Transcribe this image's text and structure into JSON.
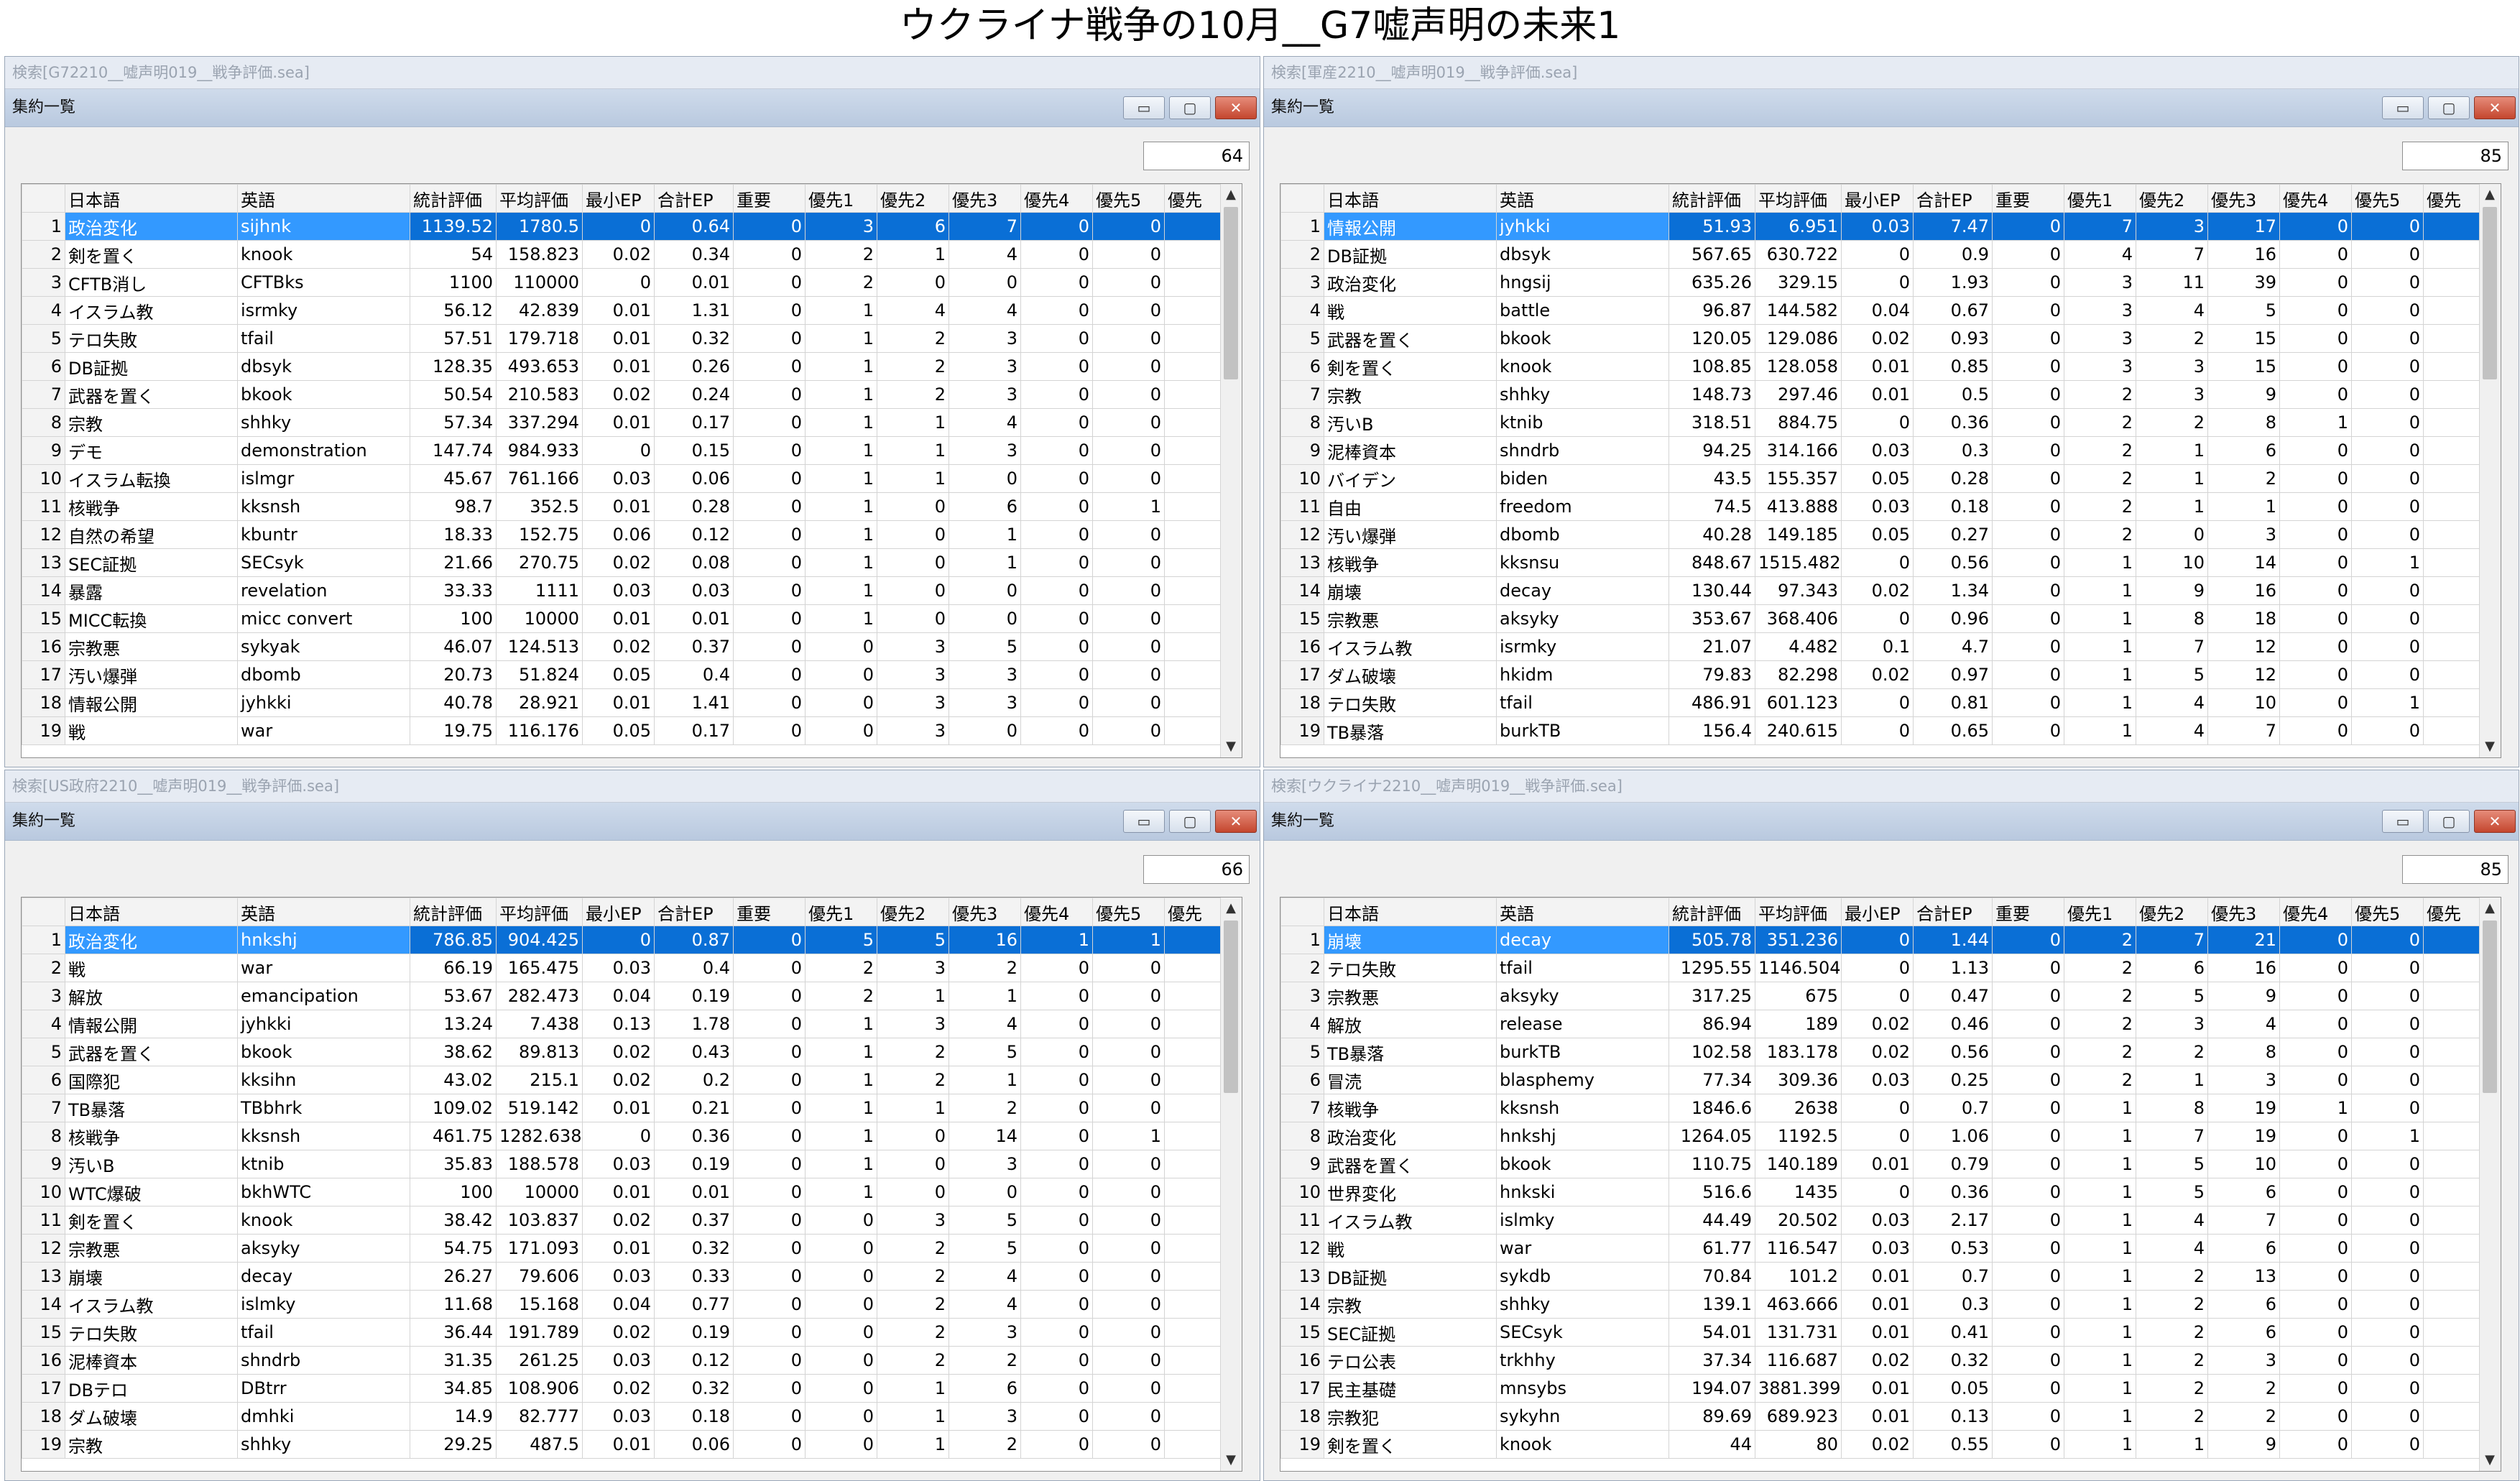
{
  "page_title": "ウクライナ戦争の10月__G7嘘声明の未来1",
  "columns": [
    "日本語",
    "英語",
    "統計評価",
    "平均評価",
    "最小EP",
    "合計EP",
    "重要",
    "優先1",
    "優先2",
    "優先3",
    "優先4",
    "優先5",
    "優先"
  ],
  "window_buttons": {
    "minimize": "▭",
    "maximize": "▢",
    "close": "✕"
  },
  "scroll_arrows": {
    "up": "▲",
    "down": "▼"
  },
  "panels": [
    {
      "window_title": "検索[G72210__嘘声明019__戦争評価.sea]",
      "list_title": "集約一覧",
      "count": "64",
      "rows": [
        [
          "1",
          "政治変化",
          "sijhnk",
          "1139.52",
          "1780.5",
          "0",
          "0.64",
          "0",
          "3",
          "6",
          "7",
          "0",
          "0"
        ],
        [
          "2",
          "剣を置く",
          "knook",
          "54",
          "158.823",
          "0.02",
          "0.34",
          "0",
          "2",
          "1",
          "4",
          "0",
          "0"
        ],
        [
          "3",
          "CFTB消し",
          "CFTBks",
          "1100",
          "110000",
          "0",
          "0.01",
          "0",
          "2",
          "0",
          "0",
          "0",
          "0"
        ],
        [
          "4",
          "イスラム教",
          "isrmky",
          "56.12",
          "42.839",
          "0.01",
          "1.31",
          "0",
          "1",
          "4",
          "4",
          "0",
          "0"
        ],
        [
          "5",
          "テロ失敗",
          "tfail",
          "57.51",
          "179.718",
          "0.01",
          "0.32",
          "0",
          "1",
          "2",
          "3",
          "0",
          "0"
        ],
        [
          "6",
          "DB証拠",
          "dbsyk",
          "128.35",
          "493.653",
          "0.01",
          "0.26",
          "0",
          "1",
          "2",
          "3",
          "0",
          "0"
        ],
        [
          "7",
          "武器を置く",
          "bkook",
          "50.54",
          "210.583",
          "0.02",
          "0.24",
          "0",
          "1",
          "2",
          "3",
          "0",
          "0"
        ],
        [
          "8",
          "宗教",
          "shhky",
          "57.34",
          "337.294",
          "0.01",
          "0.17",
          "0",
          "1",
          "1",
          "4",
          "0",
          "0"
        ],
        [
          "9",
          "デモ",
          "demonstration",
          "147.74",
          "984.933",
          "0",
          "0.15",
          "0",
          "1",
          "1",
          "3",
          "0",
          "0"
        ],
        [
          "10",
          "イスラム転換",
          "islmgr",
          "45.67",
          "761.166",
          "0.03",
          "0.06",
          "0",
          "1",
          "1",
          "0",
          "0",
          "0"
        ],
        [
          "11",
          "核戦争",
          "kksnsh",
          "98.7",
          "352.5",
          "0.01",
          "0.28",
          "0",
          "1",
          "0",
          "6",
          "0",
          "1"
        ],
        [
          "12",
          "自然の希望",
          "kbuntr",
          "18.33",
          "152.75",
          "0.06",
          "0.12",
          "0",
          "1",
          "0",
          "1",
          "0",
          "0"
        ],
        [
          "13",
          "SEC証拠",
          "SECsyk",
          "21.66",
          "270.75",
          "0.02",
          "0.08",
          "0",
          "1",
          "0",
          "1",
          "0",
          "0"
        ],
        [
          "14",
          "暴露",
          "revelation",
          "33.33",
          "1111",
          "0.03",
          "0.03",
          "0",
          "1",
          "0",
          "0",
          "0",
          "0"
        ],
        [
          "15",
          "MICC転換",
          "micc convert",
          "100",
          "10000",
          "0.01",
          "0.01",
          "0",
          "1",
          "0",
          "0",
          "0",
          "0"
        ],
        [
          "16",
          "宗教悪",
          "sykyak",
          "46.07",
          "124.513",
          "0.02",
          "0.37",
          "0",
          "0",
          "3",
          "5",
          "0",
          "0"
        ],
        [
          "17",
          "汚い爆弾",
          "dbomb",
          "20.73",
          "51.824",
          "0.05",
          "0.4",
          "0",
          "0",
          "3",
          "3",
          "0",
          "0"
        ],
        [
          "18",
          "情報公開",
          "jyhkki",
          "40.78",
          "28.921",
          "0.01",
          "1.41",
          "0",
          "0",
          "3",
          "3",
          "0",
          "0"
        ],
        [
          "19",
          "戦",
          "war",
          "19.75",
          "116.176",
          "0.05",
          "0.17",
          "0",
          "0",
          "3",
          "0",
          "0",
          "0"
        ]
      ]
    },
    {
      "window_title": "検索[軍産2210__嘘声明019__戦争評価.sea]",
      "list_title": "集約一覧",
      "count": "85",
      "rows": [
        [
          "1",
          "情報公開",
          "jyhkki",
          "51.93",
          "6.951",
          "0.03",
          "7.47",
          "0",
          "7",
          "3",
          "17",
          "0",
          "0"
        ],
        [
          "2",
          "DB証拠",
          "dbsyk",
          "567.65",
          "630.722",
          "0",
          "0.9",
          "0",
          "4",
          "7",
          "16",
          "0",
          "0"
        ],
        [
          "3",
          "政治変化",
          "hngsij",
          "635.26",
          "329.15",
          "0",
          "1.93",
          "0",
          "3",
          "11",
          "39",
          "0",
          "0"
        ],
        [
          "4",
          "戦",
          "battle",
          "96.87",
          "144.582",
          "0.04",
          "0.67",
          "0",
          "3",
          "4",
          "5",
          "0",
          "0"
        ],
        [
          "5",
          "武器を置く",
          "bkook",
          "120.05",
          "129.086",
          "0.02",
          "0.93",
          "0",
          "3",
          "2",
          "15",
          "0",
          "0"
        ],
        [
          "6",
          "剣を置く",
          "knook",
          "108.85",
          "128.058",
          "0.01",
          "0.85",
          "0",
          "3",
          "3",
          "15",
          "0",
          "0"
        ],
        [
          "7",
          "宗教",
          "shhky",
          "148.73",
          "297.46",
          "0.01",
          "0.5",
          "0",
          "2",
          "3",
          "9",
          "0",
          "0"
        ],
        [
          "8",
          "汚いB",
          "ktnib",
          "318.51",
          "884.75",
          "0",
          "0.36",
          "0",
          "2",
          "2",
          "8",
          "1",
          "0"
        ],
        [
          "9",
          "泥棒資本",
          "shndrb",
          "94.25",
          "314.166",
          "0.03",
          "0.3",
          "0",
          "2",
          "1",
          "6",
          "0",
          "0"
        ],
        [
          "10",
          "バイデン",
          "biden",
          "43.5",
          "155.357",
          "0.05",
          "0.28",
          "0",
          "2",
          "1",
          "2",
          "0",
          "0"
        ],
        [
          "11",
          "自由",
          "freedom",
          "74.5",
          "413.888",
          "0.03",
          "0.18",
          "0",
          "2",
          "1",
          "1",
          "0",
          "0"
        ],
        [
          "12",
          "汚い爆弾",
          "dbomb",
          "40.28",
          "149.185",
          "0.05",
          "0.27",
          "0",
          "2",
          "0",
          "3",
          "0",
          "0"
        ],
        [
          "13",
          "核戦争",
          "kksnsu",
          "848.67",
          "1515.482",
          "0",
          "0.56",
          "0",
          "1",
          "10",
          "14",
          "0",
          "1"
        ],
        [
          "14",
          "崩壊",
          "decay",
          "130.44",
          "97.343",
          "0.02",
          "1.34",
          "0",
          "1",
          "9",
          "16",
          "0",
          "0"
        ],
        [
          "15",
          "宗教悪",
          "aksyky",
          "353.67",
          "368.406",
          "0",
          "0.96",
          "0",
          "1",
          "8",
          "18",
          "0",
          "0"
        ],
        [
          "16",
          "イスラム教",
          "isrmky",
          "21.07",
          "4.482",
          "0.1",
          "4.7",
          "0",
          "1",
          "7",
          "12",
          "0",
          "0"
        ],
        [
          "17",
          "ダム破壊",
          "hkidm",
          "79.83",
          "82.298",
          "0.02",
          "0.97",
          "0",
          "1",
          "5",
          "12",
          "0",
          "0"
        ],
        [
          "18",
          "テロ失敗",
          "tfail",
          "486.91",
          "601.123",
          "0",
          "0.81",
          "0",
          "1",
          "4",
          "10",
          "0",
          "1"
        ],
        [
          "19",
          "TB暴落",
          "burkTB",
          "156.4",
          "240.615",
          "0",
          "0.65",
          "0",
          "1",
          "4",
          "7",
          "0",
          "0"
        ]
      ]
    },
    {
      "window_title": "検索[US政府2210__嘘声明019__戦争評価.sea]",
      "list_title": "集約一覧",
      "count": "66",
      "rows": [
        [
          "1",
          "政治変化",
          "hnkshj",
          "786.85",
          "904.425",
          "0",
          "0.87",
          "0",
          "5",
          "5",
          "16",
          "1",
          "1"
        ],
        [
          "2",
          "戦",
          "war",
          "66.19",
          "165.475",
          "0.03",
          "0.4",
          "0",
          "2",
          "3",
          "2",
          "0",
          "0"
        ],
        [
          "3",
          "解放",
          "emancipation",
          "53.67",
          "282.473",
          "0.04",
          "0.19",
          "0",
          "2",
          "1",
          "1",
          "0",
          "0"
        ],
        [
          "4",
          "情報公開",
          "jyhkki",
          "13.24",
          "7.438",
          "0.13",
          "1.78",
          "0",
          "1",
          "3",
          "4",
          "0",
          "0"
        ],
        [
          "5",
          "武器を置く",
          "bkook",
          "38.62",
          "89.813",
          "0.02",
          "0.43",
          "0",
          "1",
          "2",
          "5",
          "0",
          "0"
        ],
        [
          "6",
          "国際犯",
          "kksihn",
          "43.02",
          "215.1",
          "0.02",
          "0.2",
          "0",
          "1",
          "2",
          "1",
          "0",
          "0"
        ],
        [
          "7",
          "TB暴落",
          "TBbhrk",
          "109.02",
          "519.142",
          "0.01",
          "0.21",
          "0",
          "1",
          "1",
          "2",
          "0",
          "0"
        ],
        [
          "8",
          "核戦争",
          "kksnsh",
          "461.75",
          "1282.638",
          "0",
          "0.36",
          "0",
          "1",
          "0",
          "14",
          "0",
          "1"
        ],
        [
          "9",
          "汚いB",
          "ktnib",
          "35.83",
          "188.578",
          "0.03",
          "0.19",
          "0",
          "1",
          "0",
          "3",
          "0",
          "0"
        ],
        [
          "10",
          "WTC爆破",
          "bkhWTC",
          "100",
          "10000",
          "0.01",
          "0.01",
          "0",
          "1",
          "0",
          "0",
          "0",
          "0"
        ],
        [
          "11",
          "剣を置く",
          "knook",
          "38.42",
          "103.837",
          "0.02",
          "0.37",
          "0",
          "0",
          "3",
          "5",
          "0",
          "0"
        ],
        [
          "12",
          "宗教悪",
          "aksyky",
          "54.75",
          "171.093",
          "0.01",
          "0.32",
          "0",
          "0",
          "2",
          "5",
          "0",
          "0"
        ],
        [
          "13",
          "崩壊",
          "decay",
          "26.27",
          "79.606",
          "0.03",
          "0.33",
          "0",
          "0",
          "2",
          "4",
          "0",
          "0"
        ],
        [
          "14",
          "イスラム教",
          "islmky",
          "11.68",
          "15.168",
          "0.04",
          "0.77",
          "0",
          "0",
          "2",
          "4",
          "0",
          "0"
        ],
        [
          "15",
          "テロ失敗",
          "tfail",
          "36.44",
          "191.789",
          "0.02",
          "0.19",
          "0",
          "0",
          "2",
          "3",
          "0",
          "0"
        ],
        [
          "16",
          "泥棒資本",
          "shndrb",
          "31.35",
          "261.25",
          "0.03",
          "0.12",
          "0",
          "0",
          "2",
          "2",
          "0",
          "0"
        ],
        [
          "17",
          "DBテロ",
          "DBtrr",
          "34.85",
          "108.906",
          "0.02",
          "0.32",
          "0",
          "0",
          "1",
          "6",
          "0",
          "0"
        ],
        [
          "18",
          "ダム破壊",
          "dmhki",
          "14.9",
          "82.777",
          "0.03",
          "0.18",
          "0",
          "0",
          "1",
          "3",
          "0",
          "0"
        ],
        [
          "19",
          "宗教",
          "shhky",
          "29.25",
          "487.5",
          "0.01",
          "0.06",
          "0",
          "0",
          "1",
          "2",
          "0",
          "0"
        ]
      ]
    },
    {
      "window_title": "検索[ウクライナ2210__嘘声明019__戦争評価.sea]",
      "list_title": "集約一覧",
      "count": "85",
      "rows": [
        [
          "1",
          "崩壊",
          "decay",
          "505.78",
          "351.236",
          "0",
          "1.44",
          "0",
          "2",
          "7",
          "21",
          "0",
          "0"
        ],
        [
          "2",
          "テロ失敗",
          "tfail",
          "1295.55",
          "1146.504",
          "0",
          "1.13",
          "0",
          "2",
          "6",
          "16",
          "0",
          "0"
        ],
        [
          "3",
          "宗教悪",
          "aksyky",
          "317.25",
          "675",
          "0",
          "0.47",
          "0",
          "2",
          "5",
          "9",
          "0",
          "0"
        ],
        [
          "4",
          "解放",
          "release",
          "86.94",
          "189",
          "0.02",
          "0.46",
          "0",
          "2",
          "3",
          "4",
          "0",
          "0"
        ],
        [
          "5",
          "TB暴落",
          "burkTB",
          "102.58",
          "183.178",
          "0.02",
          "0.56",
          "0",
          "2",
          "2",
          "8",
          "0",
          "0"
        ],
        [
          "6",
          "冒涜",
          "blasphemy",
          "77.34",
          "309.36",
          "0.03",
          "0.25",
          "0",
          "2",
          "1",
          "3",
          "0",
          "0"
        ],
        [
          "7",
          "核戦争",
          "kksnsh",
          "1846.6",
          "2638",
          "0",
          "0.7",
          "0",
          "1",
          "8",
          "19",
          "1",
          "0"
        ],
        [
          "8",
          "政治変化",
          "hnkshj",
          "1264.05",
          "1192.5",
          "0",
          "1.06",
          "0",
          "1",
          "7",
          "19",
          "0",
          "1"
        ],
        [
          "9",
          "武器を置く",
          "bkook",
          "110.75",
          "140.189",
          "0.01",
          "0.79",
          "0",
          "1",
          "5",
          "10",
          "0",
          "0"
        ],
        [
          "10",
          "世界変化",
          "hnkski",
          "516.6",
          "1435",
          "0",
          "0.36",
          "0",
          "1",
          "5",
          "6",
          "0",
          "0"
        ],
        [
          "11",
          "イスラム教",
          "islmky",
          "44.49",
          "20.502",
          "0.03",
          "2.17",
          "0",
          "1",
          "4",
          "7",
          "0",
          "0"
        ],
        [
          "12",
          "戦",
          "war",
          "61.77",
          "116.547",
          "0.03",
          "0.53",
          "0",
          "1",
          "4",
          "6",
          "0",
          "0"
        ],
        [
          "13",
          "DB証拠",
          "sykdb",
          "70.84",
          "101.2",
          "0.01",
          "0.7",
          "0",
          "1",
          "2",
          "13",
          "0",
          "0"
        ],
        [
          "14",
          "宗教",
          "shhky",
          "139.1",
          "463.666",
          "0.01",
          "0.3",
          "0",
          "1",
          "2",
          "6",
          "0",
          "0"
        ],
        [
          "15",
          "SEC証拠",
          "SECsyk",
          "54.01",
          "131.731",
          "0.01",
          "0.41",
          "0",
          "1",
          "2",
          "6",
          "0",
          "0"
        ],
        [
          "16",
          "テロ公表",
          "trkhhy",
          "37.34",
          "116.687",
          "0.02",
          "0.32",
          "0",
          "1",
          "2",
          "3",
          "0",
          "0"
        ],
        [
          "17",
          "民主基礎",
          "mnsybs",
          "194.07",
          "3881.399",
          "0.01",
          "0.05",
          "0",
          "1",
          "2",
          "2",
          "0",
          "0"
        ],
        [
          "18",
          "宗教犯",
          "sykyhn",
          "89.69",
          "689.923",
          "0.01",
          "0.13",
          "0",
          "1",
          "2",
          "2",
          "0",
          "0"
        ],
        [
          "19",
          "剣を置く",
          "knook",
          "44",
          "80",
          "0.02",
          "0.55",
          "0",
          "1",
          "1",
          "9",
          "0",
          "0"
        ]
      ]
    }
  ]
}
